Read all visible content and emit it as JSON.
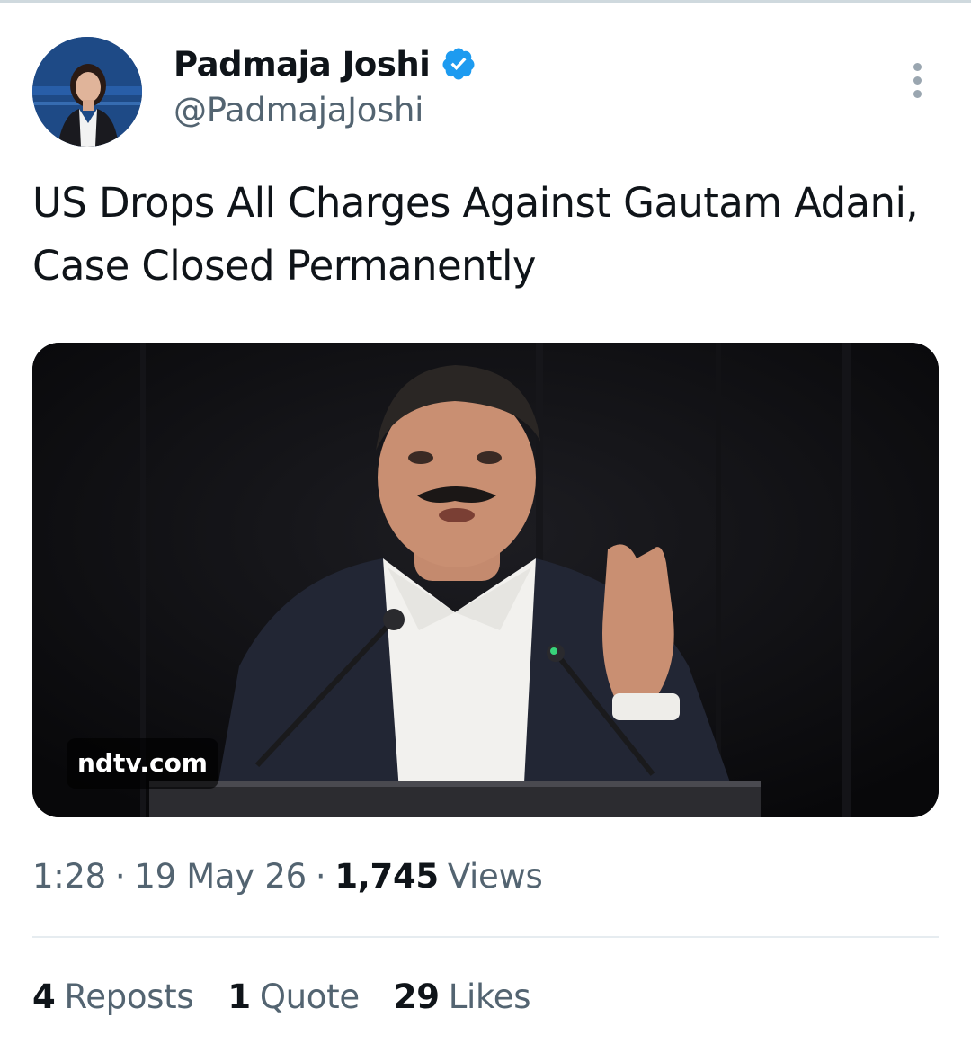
{
  "author": {
    "name": "Padmaja Joshi",
    "handle": "@PadmajaJoshi",
    "verified": true
  },
  "tweet": {
    "text": "US Drops All Charges Against Gautam Adani, Case Closed Permanently"
  },
  "media": {
    "source_label": "ndtv.com"
  },
  "meta": {
    "time": "1:28",
    "separator": "·",
    "date": "19 May 26",
    "views_count": "1,745",
    "views_label": "Views"
  },
  "stats": {
    "reposts_count": "4",
    "reposts_label": "Reposts",
    "quotes_count": "1",
    "quotes_label": "Quote",
    "likes_count": "29",
    "likes_label": "Likes"
  },
  "icons": {
    "verified": "verified-badge-icon",
    "more": "more-options-icon"
  },
  "colors": {
    "text_primary": "#0f1419",
    "text_secondary": "#536471",
    "verified_blue": "#1d9bf0",
    "divider": "#e6ecf0"
  }
}
